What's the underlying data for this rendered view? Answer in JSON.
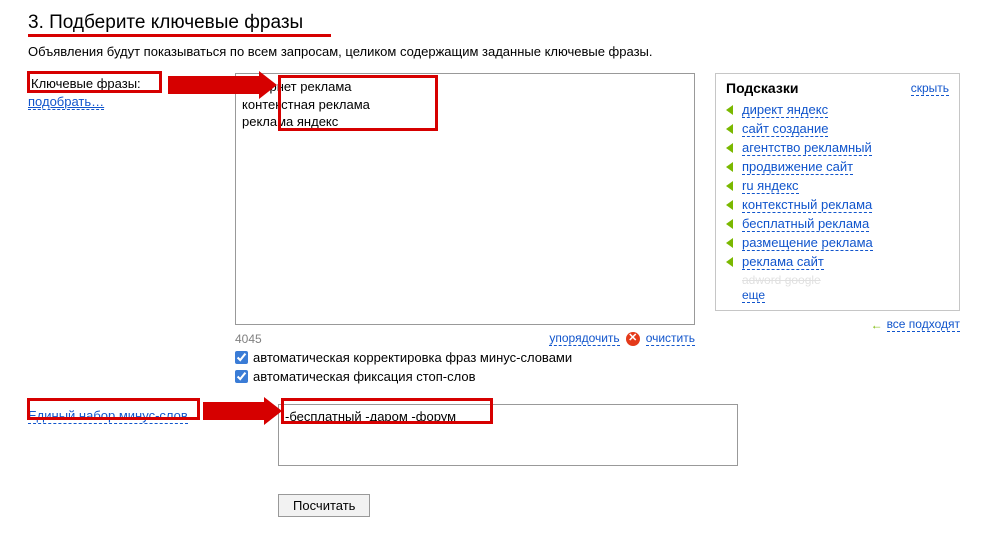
{
  "section": {
    "title": "3. Подберите ключевые фразы",
    "description": "Объявления будут показываться по всем запросам, целиком содержащим заданные ключевые фразы."
  },
  "keywords": {
    "label": "Ключевые фразы:",
    "pick_link": "подобрать…",
    "value": "интернет реклама\nконтекстная реклама\nреклама яндекс",
    "char_count": "4045",
    "sort_link": "упорядочить",
    "clear_link": "очистить",
    "chk_auto_minus": "автоматическая корректировка фраз минус-словами",
    "chk_stop_words": "автоматическая фиксация стоп-слов"
  },
  "hints": {
    "title": "Подсказки",
    "hide": "скрыть",
    "items": [
      "директ яндекс",
      "сайт создание",
      "агентство рекламный",
      "продвижение сайт",
      "ru яндекс",
      "контекстный реклама",
      "бесплатный реклама",
      "размещение реклама",
      "реклама сайт"
    ],
    "more_cutoff": "adword google",
    "more": "еще",
    "footer_link": "все подходят"
  },
  "minus": {
    "label": "Единый набор минус-слов",
    "value": "-бесплатный -даром -форум"
  },
  "footer": {
    "count_btn": "Посчитать"
  }
}
